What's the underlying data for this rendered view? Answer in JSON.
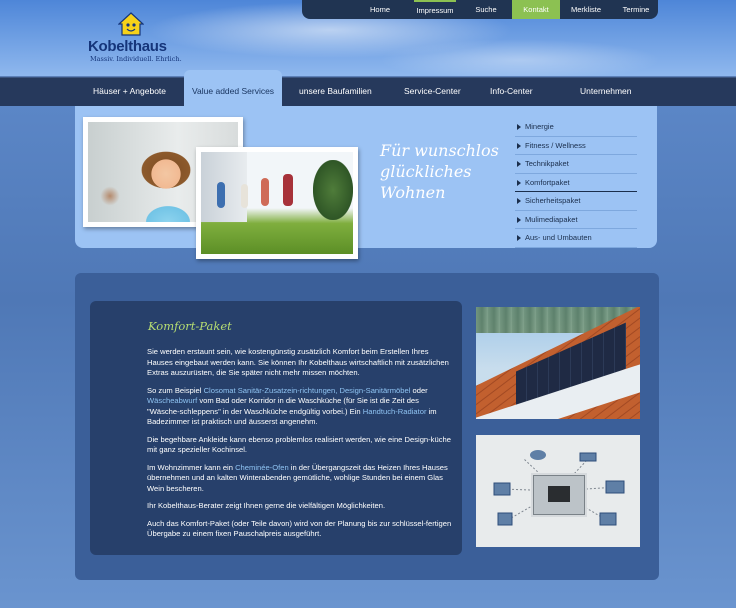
{
  "logo": {
    "brand": "Kobelthaus",
    "tagline": "Massiv. Individuell. Ehrlich."
  },
  "top_nav": [
    {
      "label": "Home",
      "active": false
    },
    {
      "label": "Impressum",
      "active": false
    },
    {
      "label": "Suche",
      "active": false
    },
    {
      "label": "Kontakt",
      "active": true
    },
    {
      "label": "Merkliste",
      "active": false
    },
    {
      "label": "Termine",
      "active": false
    }
  ],
  "main_nav": [
    {
      "label": "Häuser + Angebote",
      "active": false
    },
    {
      "label": "Value added Services",
      "active": true
    },
    {
      "label": "unsere Baufamilien",
      "active": false
    },
    {
      "label": "Service-Center",
      "active": false
    },
    {
      "label": "Info-Center",
      "active": false
    },
    {
      "label": "Unternehmen",
      "active": false
    }
  ],
  "hero": {
    "slogan": "Für wunschlos glückliches Wohnen"
  },
  "sub_menu": [
    {
      "label": "Minergie",
      "active": false
    },
    {
      "label": "Fitness / Wellness",
      "active": false
    },
    {
      "label": "Technikpaket",
      "active": false
    },
    {
      "label": "Komfortpaket",
      "active": true
    },
    {
      "label": "Sicherheitspaket",
      "active": false
    },
    {
      "label": "Mulimediapaket",
      "active": false
    },
    {
      "label": "Aus- und Umbauten",
      "active": false
    }
  ],
  "content": {
    "title": "Komfort-Paket",
    "p1": "Sie werden erstaunt sein, wie kostengünstig zusätzlich Komfort beim Erstellen Ihres Hauses eingebaut werden kann. Sie können Ihr Kobelthaus wirtschaftlich mit zusätzlichen Extras auszurüsten, die Sie später nicht mehr missen möchten.",
    "p2_a": "So zum Beispiel ",
    "p2_link1": "Closomat Sanitär-Zusatzein-richtungen, Design-Sanitärmöbel",
    "p2_b": " oder ",
    "p2_link2": "Wäscheabwurf",
    "p2_c": " vom Bad oder Korridor in die Waschküche (für Sie ist die Zeit des \"Wäsche-schleppens\" in der Waschküche endgültig vorbei.) Ein ",
    "p2_link3": "Handtuch-Radiator",
    "p2_d": " im Badezimmer ist praktisch und äusserst angenehm.",
    "p3": "Die begehbare Ankleide kann ebenso problemlos realisiert werden, wie eine Design-küche mit ganz spezieller Kochinsel.",
    "p4_a": "Im Wohnzimmer kann ein ",
    "p4_link": "Cheminée-Ofen",
    "p4_b": " in der Übergangszeit das Heizen Ihres Hauses übernehmen und an kalten Winterabenden gemütliche, wohlige Stunden bei einem Glas Wein bescheren.",
    "p5": "Ihr Kobelthaus-Berater zeigt Ihnen gerne die vielfältigen Möglichkeiten.",
    "p6": "Auch das Komfort-Paket (oder Teile davon) wird von der Planung bis zur schlüssel-fertigen Übergabe zu einem fixen Pauschalpreis ausgeführt."
  },
  "colors": {
    "accent_green": "#8cc152",
    "nav_dark": "#26395c",
    "light_blue": "#9cc3f4",
    "content_blue": "#3b5f99",
    "text_box": "#27406b",
    "link": "#8fc3f2"
  },
  "icons": [
    "house-logo-icon",
    "submenu-arrow-icon"
  ]
}
